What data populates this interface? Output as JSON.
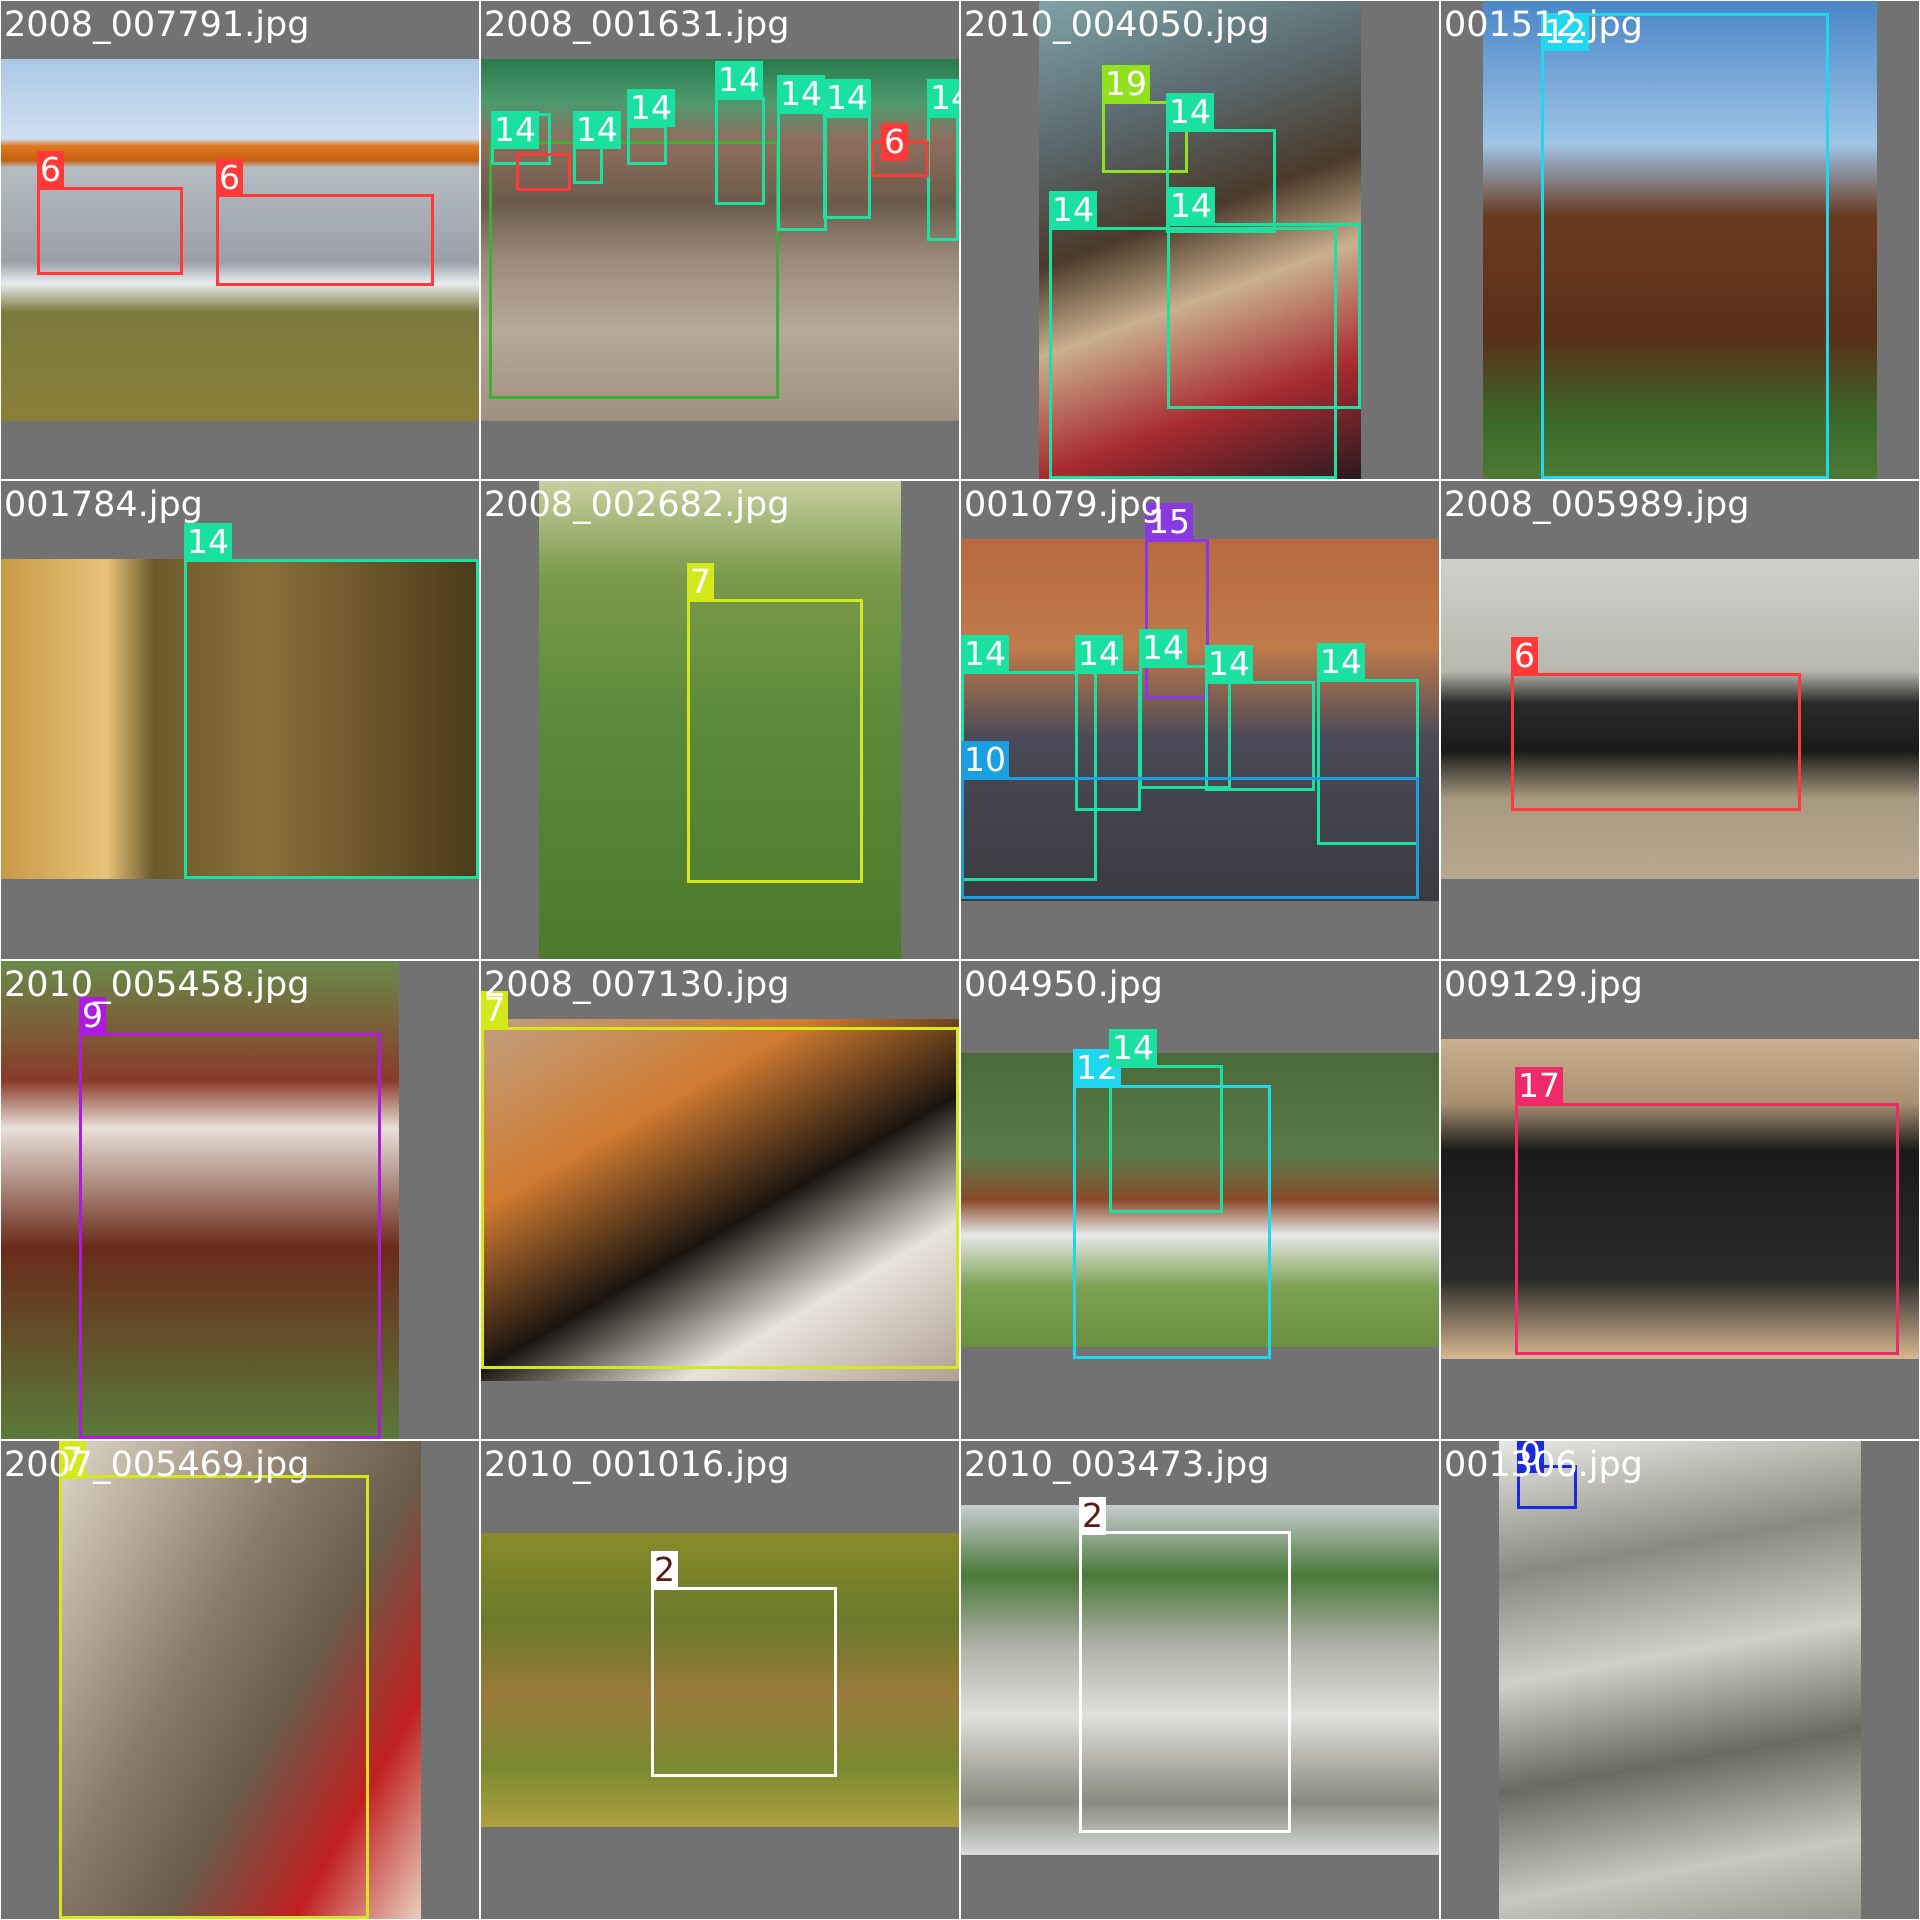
{
  "tiles": [
    {
      "filename": "2008_007791.jpg",
      "background": "linear-gradient(180deg,#a9c7e6 0%,#cfdff0 22%,#e07a22 24%,#c65f10 28%,#b5bcc2 30%,#9aa0a6 56%,#e9edf0 62%,#7c7a3c 70%,#8a7f3a 100%)",
      "labels": [
        {
          "text": "6",
          "color": "#ff3838",
          "text_dark": false
        },
        {
          "text": "6",
          "color": "#ff3838",
          "text_dark": false
        }
      ]
    },
    {
      "filename": "2008_001631.jpg",
      "background": "linear-gradient(180deg,#2a7a4d 0%,#4d9a6e 12%,#8f6f5f 22%,#6b5b4a 40%,#9b8a7a 55%,#b8a898 75%,#a09080 100%)",
      "labels": [
        {
          "text": "14",
          "color": "#1ae0a0",
          "text_dark": false
        },
        {
          "text": "14",
          "color": "#1ae0a0",
          "text_dark": false
        },
        {
          "text": "14",
          "color": "#1ae0a0",
          "text_dark": false
        },
        {
          "text": "14",
          "color": "#1ae0a0",
          "text_dark": false
        },
        {
          "text": "14",
          "color": "#1ae0a0",
          "text_dark": false
        },
        {
          "text": "14",
          "color": "#1ae0a0",
          "text_dark": false
        },
        {
          "text": "14",
          "color": "#1ae0a0",
          "text_dark": false
        },
        {
          "text": "6",
          "color": "#ff3838",
          "text_dark": false
        },
        {
          "text": "6",
          "color": "#ff3838",
          "text_dark": false
        }
      ]
    },
    {
      "filename": "2010_004050.jpg",
      "background": "linear-gradient(160deg,#7fa2a8 0%,#5a6a6f 25%,#4a3a2a 45%,#c9b08e 60%,#a82a30 80%,#2a1a20 100%)",
      "labels": [
        {
          "text": "19",
          "color": "#92e11f",
          "text_dark": false
        },
        {
          "text": "14",
          "color": "#1ae0a0",
          "text_dark": false
        },
        {
          "text": "14",
          "color": "#1ae0a0",
          "text_dark": false
        },
        {
          "text": "14",
          "color": "#1ae0a0",
          "text_dark": false
        }
      ]
    },
    {
      "filename": "001512.jpg",
      "background": "linear-gradient(180deg,#4a86c8 0%,#9fc4e6 30%,#6a3a20 45%,#5a2f18 70%,#3a6a2a 88%,#4c7a32 100%)",
      "labels": [
        {
          "text": "12",
          "color": "#1fd8f0",
          "text_dark": false
        }
      ]
    },
    {
      "filename": "001784.jpg",
      "background": "linear-gradient(90deg,#c79a45 0%,#e8c27a 22%,#6a5a2a 32%,#8b6f3a 55%,#4a3a1a 100%)",
      "labels": [
        {
          "text": "14",
          "color": "#1ae0a0",
          "text_dark": false
        }
      ]
    },
    {
      "filename": "2008_002682.jpg",
      "background": "linear-gradient(180deg,#c9cfa0 0%,#7a9a4a 20%,#5a8a3a 50%,#4a7a2a 100%)",
      "labels": [
        {
          "text": "7",
          "color": "#d4e81c",
          "text_dark": false
        }
      ]
    },
    {
      "filename": "001079.jpg",
      "background": "linear-gradient(180deg,#b86a40 0%,#c07a4a 30%,#4a4a58 55%,#3a3a40 100%)",
      "labels": [
        {
          "text": "15",
          "color": "#8a38e0",
          "text_dark": false
        },
        {
          "text": "14",
          "color": "#1ae0a0",
          "text_dark": false
        },
        {
          "text": "14",
          "color": "#1ae0a0",
          "text_dark": false
        },
        {
          "text": "14",
          "color": "#1ae0a0",
          "text_dark": false
        },
        {
          "text": "14",
          "color": "#1ae0a0",
          "text_dark": false
        },
        {
          "text": "14",
          "color": "#1ae0a0",
          "text_dark": false
        },
        {
          "text": "10",
          "color": "#1aa0e0",
          "text_dark": false
        }
      ]
    },
    {
      "filename": "2008_005989.jpg",
      "background": "linear-gradient(180deg,#d0d0cc 0%,#b8b8b0 35%,#2a2a2a 45%,#1a1a1a 60%,#a89a80 75%,#b8a890 100%)",
      "labels": [
        {
          "text": "6",
          "color": "#ff3838",
          "text_dark": false
        }
      ]
    },
    {
      "filename": "2010_005458.jpg",
      "background": "linear-gradient(180deg,#6a8a4a 0%,#8a3a2a 25%,#e8e0d8 35%,#6a2a1a 60%,#5a7a3a 100%)",
      "labels": [
        {
          "text": "9",
          "color": "#b01ae0",
          "text_dark": false
        }
      ]
    },
    {
      "filename": "2008_007130.jpg",
      "background": "linear-gradient(150deg,#c0a080 0%,#d07a30 30%,#1a1410 55%,#e8e4dc 75%,#b0a090 100%)",
      "labels": [
        {
          "text": "7",
          "color": "#d4e81c",
          "text_dark": false
        }
      ]
    },
    {
      "filename": "004950.jpg",
      "background": "linear-gradient(180deg,#4a6a3a 0%,#5a7a4a 35%,#8a4a2a 50%,#e8e8e8 62%,#7aa050 80%,#6a9040 100%)",
      "labels": [
        {
          "text": "12",
          "color": "#1fd8f0",
          "text_dark": false
        },
        {
          "text": "14",
          "color": "#1ae0a0",
          "text_dark": false
        }
      ]
    },
    {
      "filename": "009129.jpg",
      "background": "linear-gradient(180deg,#c8b090 0%,#a89070 20%,#1a1a1a 35%,#2a2a2a 75%,#d8b890 100%)",
      "labels": [
        {
          "text": "17",
          "color": "#f02a68",
          "text_dark": false
        }
      ]
    },
    {
      "filename": "2007_005469.jpg",
      "background": "linear-gradient(120deg,#e0d8c8 0%,#8a7a6a 40%,#6a5a4a 60%,#c02020 80%,#e8d0c0 100%)",
      "labels": [
        {
          "text": "7",
          "color": "#d4e81c",
          "text_dark": false
        }
      ]
    },
    {
      "filename": "2010_001016.jpg",
      "background": "linear-gradient(180deg,#8a8a2a 0%,#6a7a2a 30%,#9a7a3a 55%,#7a8a30 80%,#b0a040 100%)",
      "labels": [
        {
          "text": "2",
          "color": "#ffffff",
          "text_dark": true
        }
      ]
    },
    {
      "filename": "2010_003473.jpg",
      "background": "linear-gradient(180deg,#c8ccd0 0%,#4a7a3a 20%,#b0b0a8 40%,#e0e0dc 60%,#8a8a80 85%,#d8dcd8 100%)",
      "labels": [
        {
          "text": "2",
          "color": "#ffffff",
          "text_dark": true
        }
      ]
    },
    {
      "filename": "001306.jpg",
      "background": "linear-gradient(170deg,#e8e8e4 0%,#8a8a80 25%,#d0d0c8 45%,#6a6a60 65%,#c8c8c0 85%,#9a9a90 100%)",
      "labels": [
        {
          "text": "0",
          "color": "#1a2ae0",
          "text_dark": false
        }
      ]
    }
  ]
}
